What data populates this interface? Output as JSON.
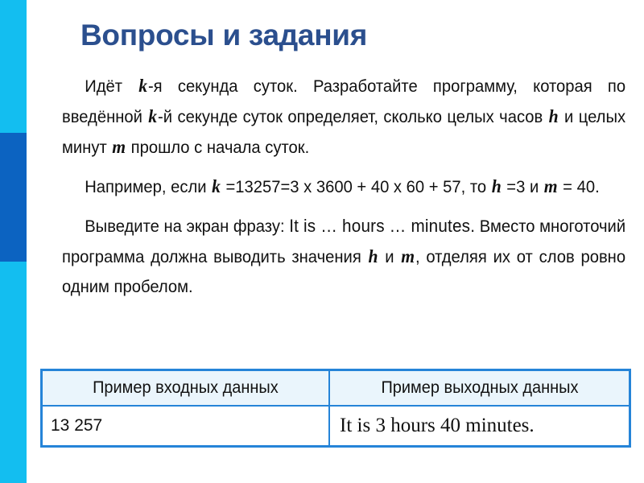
{
  "slide": {
    "title": "Вопросы и задания",
    "title_color": "#2B4F8E",
    "background_color": "#FFFFFF"
  },
  "decor": {
    "side_bar_color": "#13BEF0",
    "side_bar_accent_color": "#0C63C1"
  },
  "body": {
    "paragraph1": {
      "seg1": "Идёт ",
      "var1": "k",
      "seg2": "-я секунда суток. Разработайте программу, которая по введённой ",
      "var2": "k",
      "seg3": "-й секунде суток определяет, сколько целых часов ",
      "var3": "h",
      "seg4": " и целых минут ",
      "var4": "m",
      "seg5": " прошло с начала суток."
    },
    "paragraph2": {
      "seg1": "Например, если ",
      "var1": "k",
      "seg2": " =13257=3 x 3600 + 40 x 60 + 57, то ",
      "var2": "h",
      "seg3": " =3 и ",
      "var3": "m",
      "seg4": " = 40."
    },
    "paragraph3": {
      "seg1": "Выведите на экран фразу: ",
      "eng1": "It is … hours … minutes.",
      "seg2": " Вместо многоточий программа должна выводить значения ",
      "var1": "h",
      "seg3": " и ",
      "var2": "m",
      "seg4": ", отделяя их от слов ровно одним пробелом."
    }
  },
  "table": {
    "border_color": "#2584D8",
    "header_background": "#EAF5FC",
    "headers": [
      "Пример входных данных",
      "Пример выходных данных"
    ],
    "rows": [
      [
        "13 257",
        "It is 3 hours 40 minutes."
      ]
    ]
  }
}
